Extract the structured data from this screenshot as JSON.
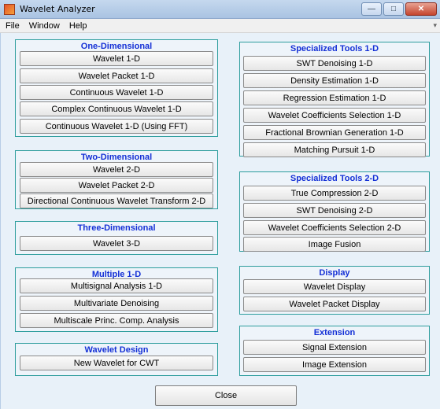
{
  "window": {
    "title": "Wavelet Analyzer",
    "minimize_glyph": "—",
    "maximize_glyph": "□",
    "close_glyph": "✕"
  },
  "menu": {
    "items": [
      "File",
      "Window",
      "Help"
    ],
    "overflow_glyph": "▾"
  },
  "panels": {
    "one_d": {
      "title": "One-Dimensional",
      "buttons": [
        "Wavelet 1-D",
        "Wavelet Packet 1-D",
        "Continuous Wavelet 1-D",
        "Complex Continuous Wavelet 1-D",
        "Continuous Wavelet 1-D (Using FFT)"
      ]
    },
    "two_d": {
      "title": "Two-Dimensional",
      "buttons": [
        "Wavelet 2-D",
        "Wavelet Packet 2-D",
        "Directional Continuous  Wavelet Transform 2-D"
      ]
    },
    "three_d": {
      "title": "Three-Dimensional",
      "buttons": [
        "Wavelet 3-D"
      ]
    },
    "multiple": {
      "title": "Multiple 1-D",
      "buttons": [
        "Multisignal Analysis 1-D",
        "Multivariate Denoising",
        "Multiscale Princ. Comp. Analysis"
      ]
    },
    "design": {
      "title": "Wavelet Design",
      "buttons": [
        "New Wavelet for CWT"
      ]
    },
    "spec1d": {
      "title": "Specialized Tools 1-D",
      "buttons": [
        "SWT Denoising 1-D",
        "Density Estimation 1-D",
        "Regression Estimation 1-D",
        "Wavelet Coefficients Selection 1-D",
        "Fractional Brownian Generation 1-D",
        "Matching Pursuit 1-D"
      ]
    },
    "spec2d": {
      "title": "Specialized Tools 2-D",
      "buttons": [
        "True Compression 2-D",
        "SWT Denoising 2-D",
        "Wavelet Coefficients Selection 2-D",
        "Image Fusion"
      ]
    },
    "display": {
      "title": "Display",
      "buttons": [
        "Wavelet Display",
        "Wavelet Packet Display"
      ]
    },
    "extension": {
      "title": "Extension",
      "buttons": [
        "Signal Extension",
        "Image Extension"
      ]
    }
  },
  "close_label": "Close"
}
